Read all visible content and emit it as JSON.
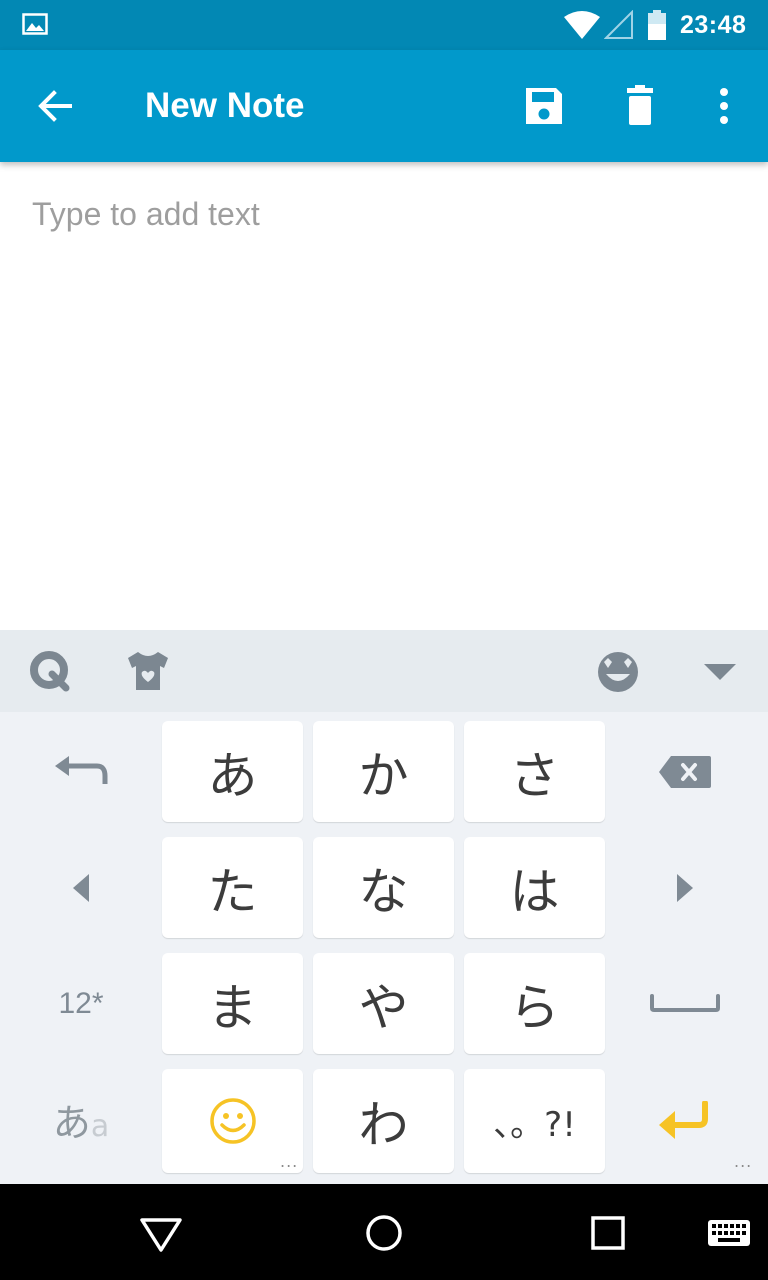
{
  "status_bar": {
    "time": "23:48"
  },
  "app_bar": {
    "title": "New Note"
  },
  "note": {
    "placeholder": "Type to add text",
    "value": ""
  },
  "keyboard": {
    "rows": [
      [
        "あ",
        "か",
        "さ"
      ],
      [
        "た",
        "な",
        "は"
      ],
      [
        "ま",
        "や",
        "ら"
      ],
      [
        "",
        "わ",
        "、。?!"
      ]
    ],
    "num_key_label": "12*",
    "mode_key_label": "あ",
    "mode_key_sub": "a",
    "more_indicator": "..."
  },
  "colors": {
    "status_bar": "#0288b4",
    "app_bar": "#0199cb",
    "keyboard_bg": "#eff2f6",
    "toolbar_bg": "#e6ebef",
    "emoji_accent": "#f6c325",
    "enter_accent": "#f6c325"
  }
}
